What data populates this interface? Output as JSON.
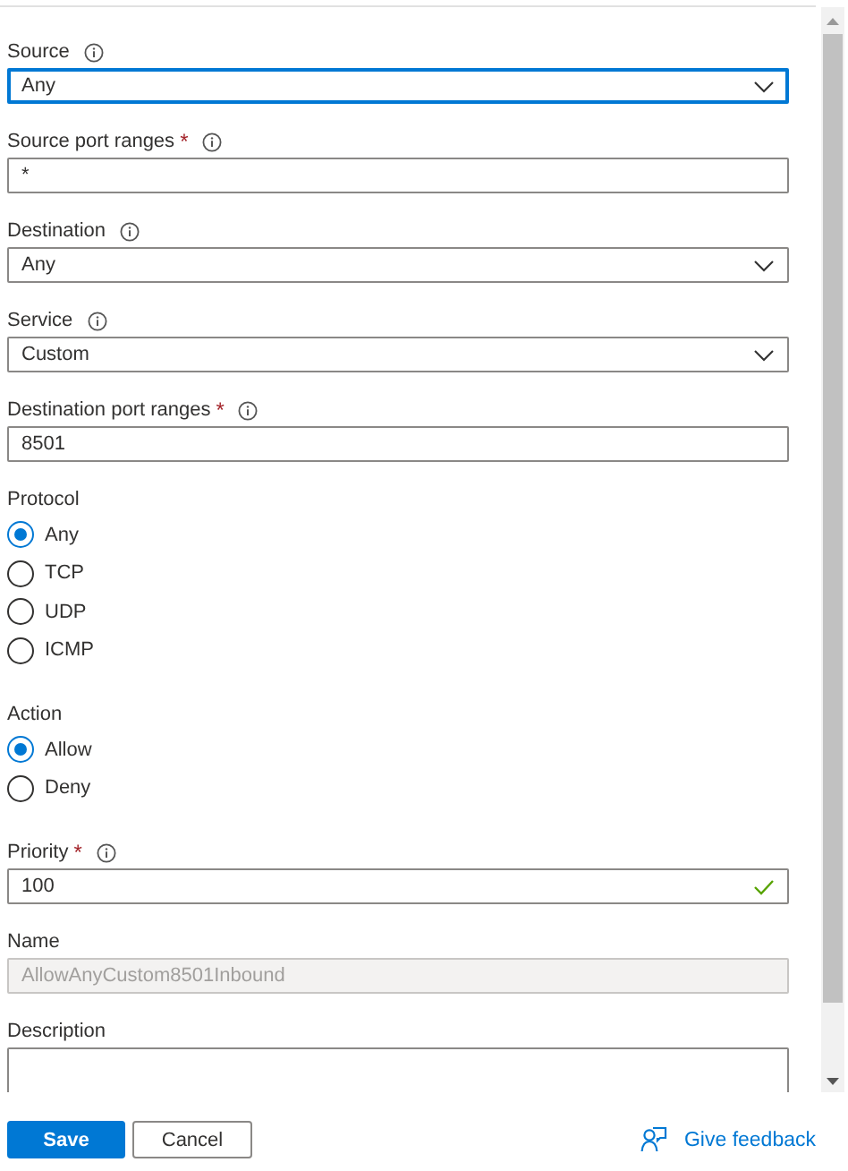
{
  "fields": [
    {
      "kind": "dropdown",
      "label": "Source",
      "info": true,
      "focused": true,
      "value": "Any"
    },
    {
      "kind": "text",
      "label": "Source port ranges",
      "required_mark": "*",
      "info": true,
      "focused": false,
      "value": "*"
    },
    {
      "kind": "dropdown",
      "label": "Destination",
      "info": true,
      "focused": false,
      "value": "Any"
    },
    {
      "kind": "dropdown",
      "label": "Service",
      "info": true,
      "focused": false,
      "value": "Custom"
    },
    {
      "kind": "text",
      "label": "Destination port ranges",
      "required_mark": "*",
      "info": true,
      "focused": false,
      "value": "8501"
    },
    {
      "kind": "radio",
      "label": "Protocol",
      "info": false,
      "options": [
        {
          "label": "Any",
          "selected": true
        },
        {
          "label": "TCP",
          "selected": false
        },
        {
          "label": "UDP",
          "selected": false
        },
        {
          "label": "ICMP",
          "selected": false
        }
      ]
    },
    {
      "kind": "radio",
      "label": "Action",
      "info": false,
      "options": [
        {
          "label": "Allow",
          "selected": true
        },
        {
          "label": "Deny",
          "selected": false
        }
      ]
    },
    {
      "kind": "text",
      "label": "Priority",
      "required_mark": "*",
      "info": true,
      "focused": false,
      "valid": true,
      "value": "100"
    },
    {
      "kind": "readonly",
      "label": "Name",
      "info": false,
      "value": "AllowAnyCustom8501Inbound"
    },
    {
      "kind": "textarea",
      "label": "Description",
      "info": false
    }
  ],
  "buttons": [
    {
      "label": "Save",
      "kind": "primary"
    },
    {
      "label": "Cancel",
      "kind": "secondary"
    }
  ],
  "feedback_link": "Give feedback"
}
